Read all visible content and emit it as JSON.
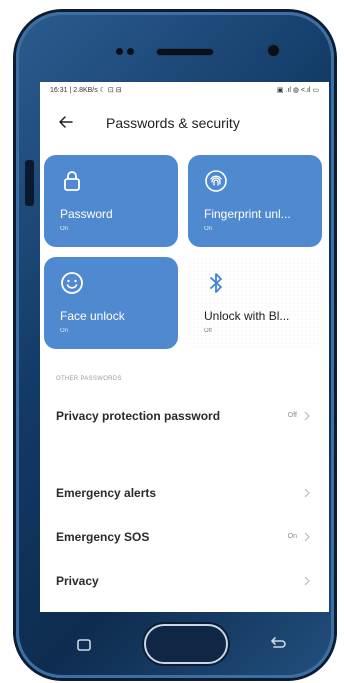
{
  "status_bar": {
    "left": "16:31 | 2.8KB/s ☾ ⊡ ⊟",
    "right": "▣ .ıl ◍ ˂.ıl ▭"
  },
  "header": {
    "title": "Passwords & security"
  },
  "tiles": [
    {
      "label": "Password",
      "state": "On",
      "icon": "lock-icon"
    },
    {
      "label": "Fingerprint unl...",
      "state": "On",
      "icon": "fingerprint-icon"
    },
    {
      "label": "Face unlock",
      "state": "On",
      "icon": "face-icon"
    },
    {
      "label": "Unlock with Bl...",
      "state": "Off",
      "icon": "bluetooth-icon"
    }
  ],
  "section_label": "OTHER PASSWORDS",
  "rows": [
    {
      "label": "Privacy protection password",
      "value": "Off"
    },
    {
      "label": "Emergency alerts",
      "value": ""
    },
    {
      "label": "Emergency SOS",
      "value": "On"
    },
    {
      "label": "Privacy",
      "value": ""
    }
  ],
  "colors": {
    "accent": "#4f8ad0",
    "phone_body": "#123a66"
  }
}
